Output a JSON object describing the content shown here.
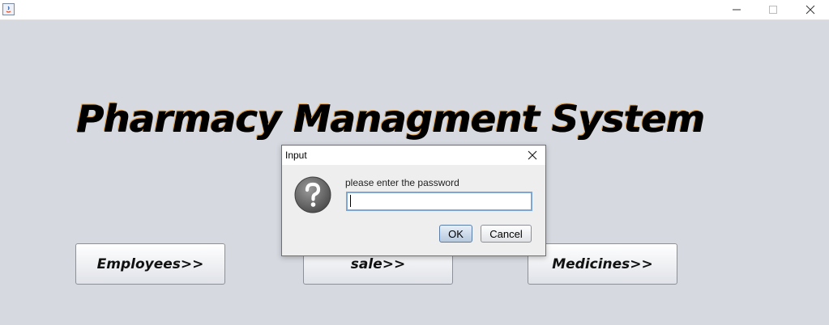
{
  "window": {
    "app_icon": "java-icon",
    "controls": [
      "minimize-icon",
      "maximize-icon",
      "close-icon"
    ]
  },
  "main": {
    "title": "Pharmacy Managment System",
    "buttons": {
      "employees": "Employees>>",
      "sale": "sale>>",
      "medicines": "Medicines>>"
    }
  },
  "dialog": {
    "title": "Input",
    "icon": "question-icon",
    "prompt": "please enter the password",
    "input_value": "",
    "ok_label": "OK",
    "cancel_label": "Cancel"
  },
  "colors": {
    "background": "#d6d9e0",
    "title_outline": "#e0a34a",
    "input_focus_border": "#7ea6d4"
  }
}
